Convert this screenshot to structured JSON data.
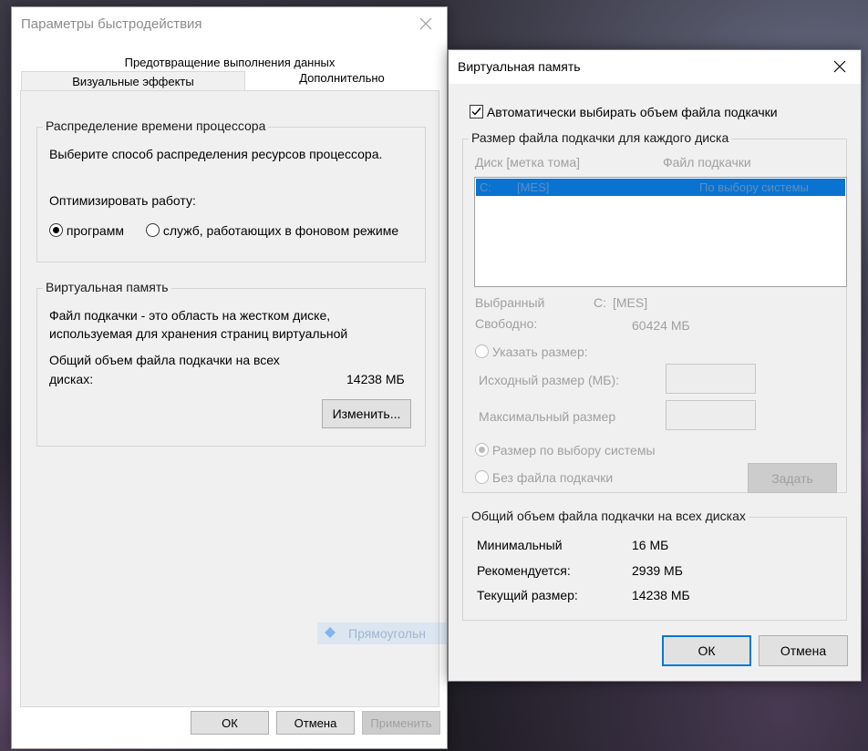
{
  "left_window": {
    "title": "Параметры быстродействия",
    "tabs": {
      "top_label": "Предотвращение выполнения данных",
      "visual_label": "Визуальные эффекты",
      "advanced_label": "Дополнительно"
    },
    "cpu_group": {
      "title": "Распределение времени процессора",
      "description": "Выберите способ распределения ресурсов процессора.",
      "optimize_label": "Оптимизировать работу:",
      "option_programs": "программ",
      "option_services": "служб, работающих в фоновом режиме",
      "selected": "programs"
    },
    "vm_group": {
      "title": "Виртуальная память",
      "desc_line1": "Файл подкачки - это область на жестком диске,",
      "desc_line2": "используемая для хранения страниц виртуальной",
      "total_line1": "Общий объем файла подкачки на всех",
      "total_line2": "дисках:",
      "total_value": "14238 МБ",
      "change_button": "Изменить..."
    },
    "buttons": {
      "ok": "ОК",
      "cancel": "Отмена",
      "apply": "Применить"
    }
  },
  "right_window": {
    "title": "Виртуальная память",
    "auto_checkbox_label": "Автоматически выбирать объем файла подкачки",
    "auto_checked": true,
    "size_group": {
      "title": "Размер файла подкачки для каждого диска",
      "col_disk": "Диск [метка тома]",
      "col_file": "Файл подкачки",
      "rows": [
        {
          "drive": "C:",
          "label": "[MES]",
          "file": "По выбору системы"
        }
      ],
      "selected_label": "Выбранный",
      "selected_drive": "C:",
      "selected_volume": "[MES]",
      "free_label": "Свободно:",
      "free_value": "60424 МБ",
      "custom_size_label": "Указать размер:",
      "initial_size_label": "Исходный размер (МБ):",
      "max_size_label": "Максимальный размер",
      "system_size_label": "Размер по выбору системы",
      "no_file_label": "Без файла подкачки",
      "set_button": "Задать"
    },
    "total_group": {
      "title": "Общий объем файла подкачки на всех дисках",
      "min_label": "Минимальный",
      "min_value": "16 МБ",
      "recommended_label": "Рекомендуется:",
      "recommended_value": "2939 МБ",
      "current_label": "Текущий размер:",
      "current_value": "14238 МБ"
    },
    "buttons": {
      "ok": "ОК",
      "cancel": "Отмена"
    }
  },
  "ghost_tooltip": "Прямоугольн",
  "colors": {
    "selection": "#0a73d1",
    "accent_border": "#0078d7",
    "disabled_text": "#a0a0a0"
  }
}
